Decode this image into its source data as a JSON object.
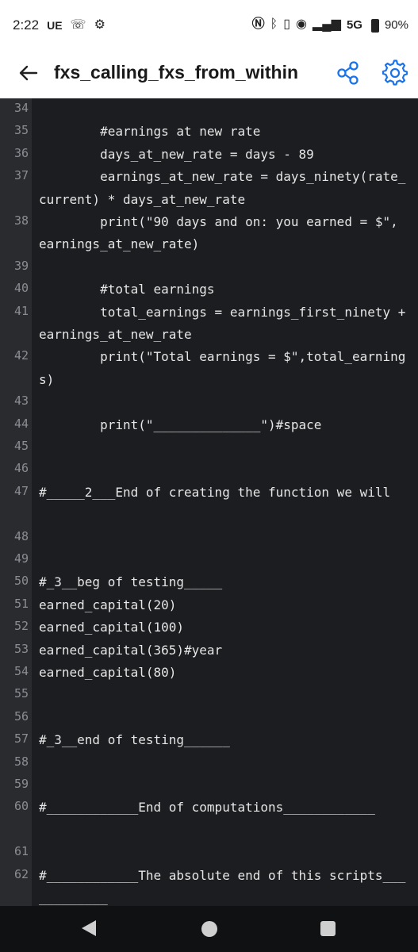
{
  "status_bar": {
    "time": "2:22",
    "carrier": "UE",
    "network": "5G",
    "battery": "90%"
  },
  "app_bar": {
    "title": "fxs_calling_fxs_from_within",
    "icons": [
      "back-arrow-icon",
      "share-icon",
      "settings-gear-icon"
    ],
    "accent_color": "#1a73e8"
  },
  "editor": {
    "lines": [
      {
        "n": "34",
        "text": ""
      },
      {
        "n": "35",
        "text": "        #earnings at new rate"
      },
      {
        "n": "36",
        "text": "        days_at_new_rate = days - 89"
      },
      {
        "n": "37",
        "text": "        earnings_at_new_rate = days_ninety(rate_current) * days_at_new_rate"
      },
      {
        "n": "38",
        "text": "        print(\"90 days and on: you earned = $\", earnings_at_new_rate)"
      },
      {
        "n": "39",
        "text": ""
      },
      {
        "n": "40",
        "text": "        #total earnings"
      },
      {
        "n": "41",
        "text": "        total_earnings = earnings_first_ninety + earnings_at_new_rate"
      },
      {
        "n": "42",
        "text": "        print(\"Total earnings = $\",total_earnings)"
      },
      {
        "n": "43",
        "text": ""
      },
      {
        "n": "44",
        "text": "        print(\"______________\")#space"
      },
      {
        "n": "45",
        "text": ""
      },
      {
        "n": "46",
        "text": ""
      },
      {
        "n": "47",
        "text": "#_____2___End of creating the function we will"
      },
      {
        "n": "48",
        "text": ""
      },
      {
        "n": "49",
        "text": ""
      },
      {
        "n": "50",
        "text": "#_3__beg of testing_____"
      },
      {
        "n": "51",
        "text": "earned_capital(20)"
      },
      {
        "n": "52",
        "text": "earned_capital(100)"
      },
      {
        "n": "53",
        "text": "earned_capital(365)#year"
      },
      {
        "n": "54",
        "text": "earned_capital(80)"
      },
      {
        "n": "55",
        "text": ""
      },
      {
        "n": "56",
        "text": ""
      },
      {
        "n": "57",
        "text": "#_3__end of testing______"
      },
      {
        "n": "58",
        "text": ""
      },
      {
        "n": "59",
        "text": ""
      },
      {
        "n": "60",
        "text": "#____________End of computations____________"
      },
      {
        "n": "61",
        "text": ""
      },
      {
        "n": "62",
        "text": "#____________The absolute end of this scripts____________"
      }
    ]
  },
  "nav_bar": {
    "icons": [
      "nav-back-icon",
      "nav-home-icon",
      "nav-recents-icon"
    ]
  }
}
